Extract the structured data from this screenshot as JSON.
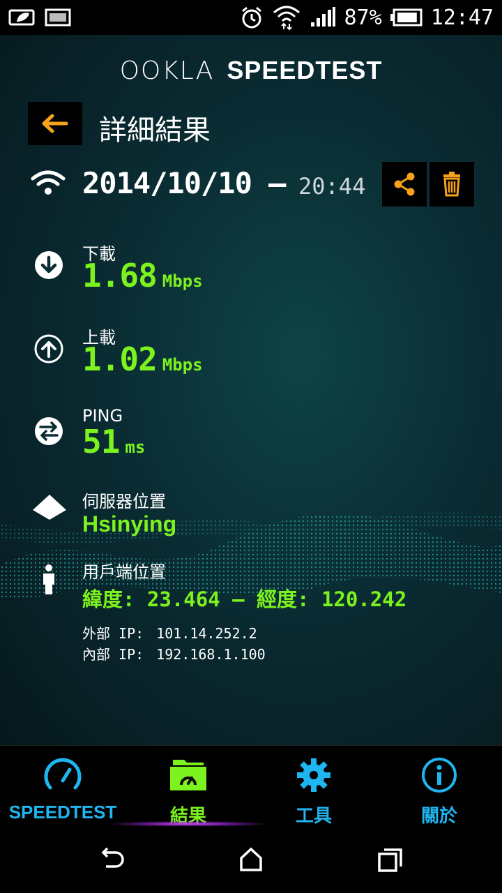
{
  "status_bar": {
    "battery_pct": "87%",
    "time": "12:47",
    "battery_level": 0.87
  },
  "header": {
    "logo_brand": "OOKLA",
    "logo_product": "SPEEDTEST",
    "title": "詳細結果"
  },
  "result": {
    "date": "2014/10/10 —",
    "time": "20:44"
  },
  "metrics": {
    "download_label": "下載",
    "download_value": "1.68",
    "download_unit": "Mbps",
    "upload_label": "上載",
    "upload_value": "1.02",
    "upload_unit": "Mbps",
    "ping_label": "PING",
    "ping_value": "51",
    "ping_unit": "ms",
    "server_label": "伺服器位置",
    "server_value": "Hsinying",
    "client_label": "用戶端位置",
    "client_value": "緯度: 23.464 — 經度: 120.242",
    "external_ip_label": "外部 IP:",
    "external_ip_value": "101.14.252.2",
    "internal_ip_label": "內部 IP:",
    "internal_ip_value": "192.168.1.100"
  },
  "tabs": [
    {
      "label": "SPEEDTEST",
      "icon": "speedometer-icon",
      "color": "#1fb5f0"
    },
    {
      "label": "結果",
      "icon": "results-folder-icon",
      "color": "#7cf21e"
    },
    {
      "label": "工具",
      "icon": "gear-icon",
      "color": "#1fb5f0"
    },
    {
      "label": "關於",
      "icon": "info-icon",
      "color": "#1fb5f0"
    }
  ],
  "colors": {
    "accent_green": "#7cf21e",
    "accent_orange": "#f7a21b",
    "tab_blue": "#1fb5f0",
    "background": "#0a2c33"
  }
}
